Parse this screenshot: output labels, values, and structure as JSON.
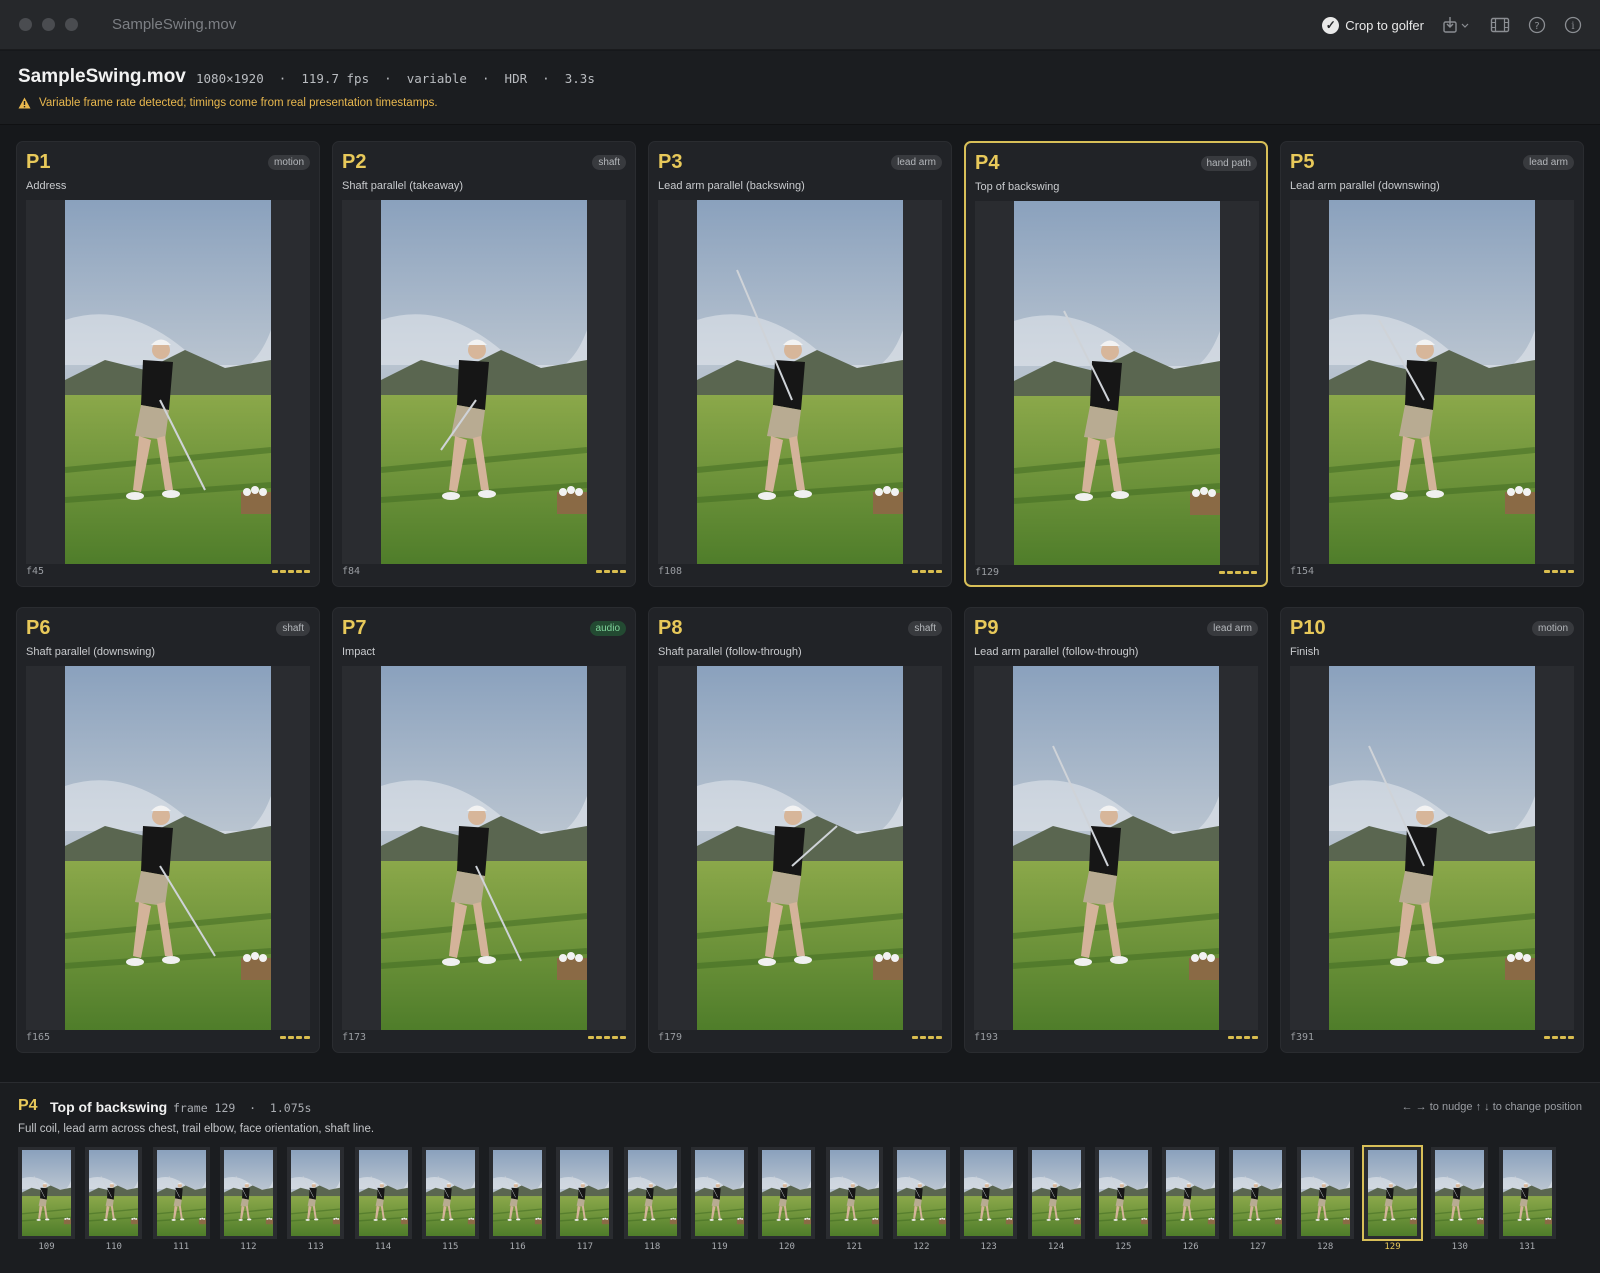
{
  "window": {
    "title": "SampleSwing.mov"
  },
  "toolbar": {
    "crop_label": "Crop to golfer",
    "crop_checked": true
  },
  "header": {
    "filename": "SampleSwing.mov",
    "meta": "1080×1920  ·  119.7 fps  ·  variable  ·  HDR  ·  3.3s",
    "warning": "Variable frame rate detected; timings come from real presentation timestamps."
  },
  "positions": [
    {
      "id": "P1",
      "label": "Address",
      "badge": "motion",
      "frame": "f45",
      "confidence": 5,
      "selected": false
    },
    {
      "id": "P2",
      "label": "Shaft parallel (takeaway)",
      "badge": "shaft",
      "frame": "f84",
      "confidence": 4,
      "selected": false
    },
    {
      "id": "P3",
      "label": "Lead arm parallel (backswing)",
      "badge": "lead arm",
      "frame": "f108",
      "confidence": 4,
      "selected": false
    },
    {
      "id": "P4",
      "label": "Top of backswing",
      "badge": "hand path",
      "frame": "f129",
      "confidence": 5,
      "selected": true
    },
    {
      "id": "P5",
      "label": "Lead arm parallel (downswing)",
      "badge": "lead arm",
      "frame": "f154",
      "confidence": 4,
      "selected": false
    },
    {
      "id": "P6",
      "label": "Shaft parallel (downswing)",
      "badge": "shaft",
      "frame": "f165",
      "confidence": 4,
      "selected": false
    },
    {
      "id": "P7",
      "label": "Impact",
      "badge": "audio",
      "frame": "f173",
      "confidence": 5,
      "selected": false
    },
    {
      "id": "P8",
      "label": "Shaft parallel (follow-through)",
      "badge": "shaft",
      "frame": "f179",
      "confidence": 4,
      "selected": false
    },
    {
      "id": "P9",
      "label": "Lead arm parallel (follow-through)",
      "badge": "lead arm",
      "frame": "f193",
      "confidence": 4,
      "selected": false
    },
    {
      "id": "P10",
      "label": "Finish",
      "badge": "motion",
      "frame": "f391",
      "confidence": 4,
      "selected": false
    }
  ],
  "detail": {
    "position": "P4",
    "title": "Top of backswing",
    "meta": "frame 129  ·  1.075s",
    "description": "Full coil, lead arm across chest, trail elbow, face orientation, shaft line.",
    "hint": "← → to nudge   ↑ ↓ to change position"
  },
  "strip": {
    "frames": [
      "109",
      "110",
      "111",
      "112",
      "113",
      "114",
      "115",
      "116",
      "117",
      "118",
      "119",
      "120",
      "121",
      "122",
      "123",
      "124",
      "125",
      "126",
      "127",
      "128",
      "129",
      "130",
      "131"
    ],
    "selected": "129"
  },
  "colors": {
    "accent": "#e8c95a",
    "selection": "#d8bf58",
    "warning": "#e9b84e",
    "audio_badge": "#7fd39a"
  }
}
